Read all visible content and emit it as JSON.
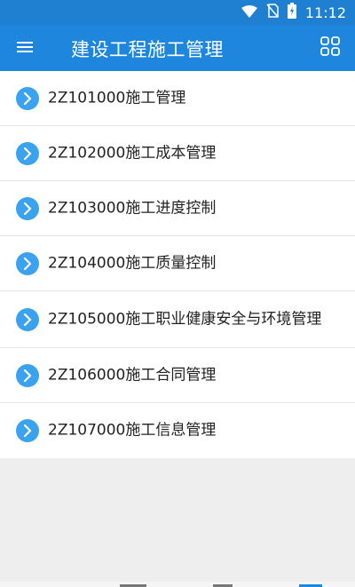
{
  "status_bar": {
    "time": "11:12",
    "icons": [
      "wifi-icon",
      "no-sim-icon",
      "battery-charging-icon"
    ]
  },
  "app_bar": {
    "title": "建设工程施工管理",
    "left_icon": "menu-icon",
    "right_icon": "grid-icon"
  },
  "chapters": [
    {
      "label": "2Z101000施工管理"
    },
    {
      "label": "2Z102000施工成本管理"
    },
    {
      "label": "2Z103000施工进度控制"
    },
    {
      "label": "2Z104000施工质量控制"
    },
    {
      "label": "2Z105000施工职业健康安全与环境管理"
    },
    {
      "label": "2Z106000施工合同管理"
    },
    {
      "label": "2Z107000施工信息管理"
    }
  ],
  "colors": {
    "app_bar": "#1f86dd",
    "status_bar": "#1f7fd0",
    "chevron_circle": "#3aa2ee",
    "background": "#eeeeee"
  }
}
